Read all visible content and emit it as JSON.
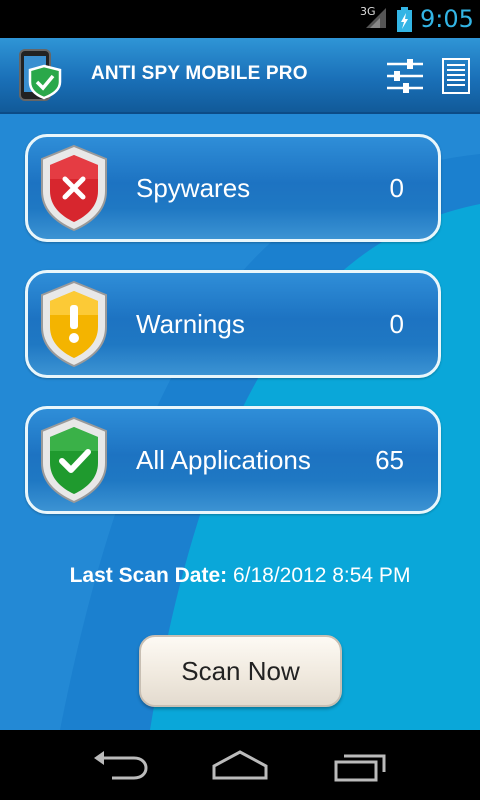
{
  "status_bar": {
    "network": "3G",
    "time": "9:05"
  },
  "header": {
    "title": "ANTI SPY MOBILE PRO",
    "icons": [
      "app-logo-icon",
      "sliders-icon",
      "list-icon"
    ]
  },
  "cards": [
    {
      "label": "Spywares",
      "count": "0",
      "icon": "red-shield-x-icon",
      "color": "#d7262e"
    },
    {
      "label": "Warnings",
      "count": "0",
      "icon": "yellow-shield-exclamation-icon",
      "color": "#f4b400"
    },
    {
      "label": "All Applications",
      "count": "65",
      "icon": "green-shield-check-icon",
      "color": "#1f9a2e"
    }
  ],
  "last_scan": {
    "label": "Last Scan Date:",
    "value": "6/18/2012 8:54 PM"
  },
  "scan_button": {
    "label": "Scan Now"
  },
  "nav": {
    "icons": [
      "back-icon",
      "home-icon",
      "recent-apps-icon"
    ]
  },
  "colors": {
    "accent": "#33b5e5",
    "background": "#0aa7d9",
    "header": "#1a70b8"
  }
}
